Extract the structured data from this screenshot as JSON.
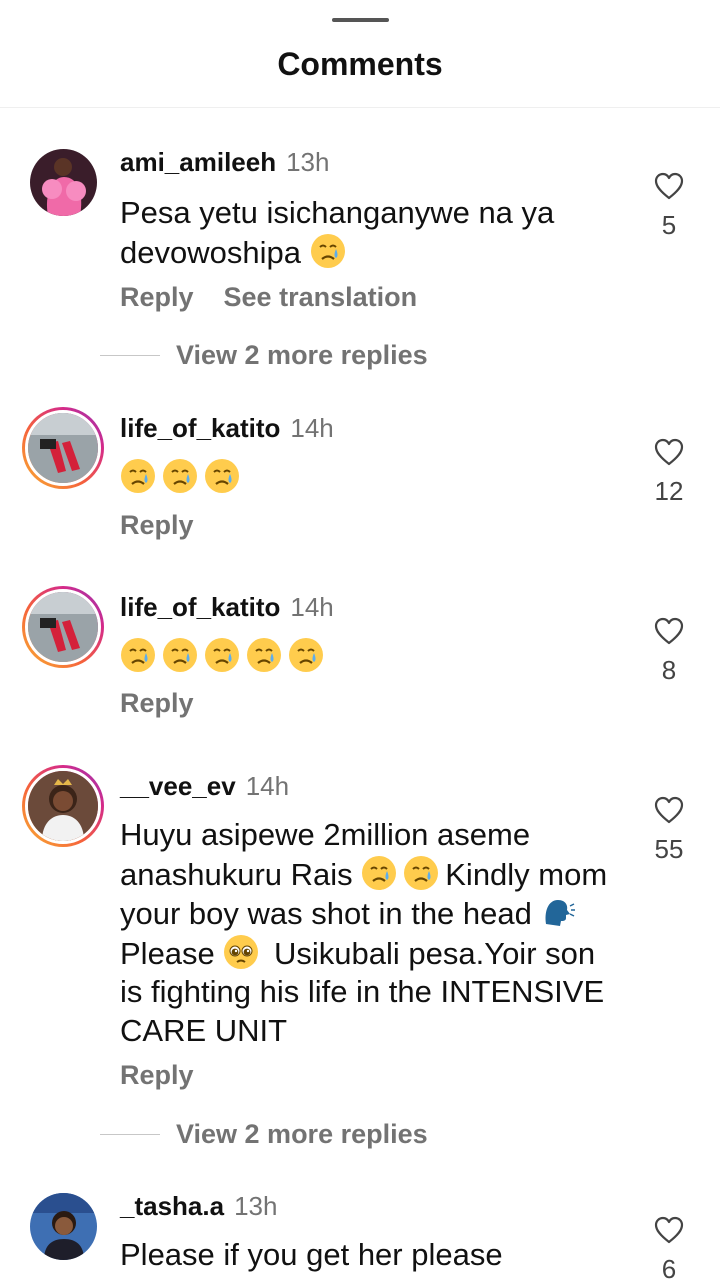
{
  "sheet": {
    "title": "Comments"
  },
  "comments": [
    {
      "username": "ami_amileeh",
      "time": "13h",
      "text": "Pesa yetu isichanganywe na ya devowoshipa",
      "emojis": [
        "crying-face"
      ],
      "reply_label": "Reply",
      "translate_label": "See translation",
      "likes": "5",
      "view_replies": "View 2 more replies",
      "avatar_icon": "avatar-pink-dress",
      "story_ring": false
    },
    {
      "username": "life_of_katito",
      "time": "14h",
      "text": "",
      "emojis": [
        "crying-face",
        "crying-face",
        "crying-face"
      ],
      "reply_label": "Reply",
      "likes": "12",
      "avatar_icon": "avatar-red-shoes",
      "story_ring": true
    },
    {
      "username": "life_of_katito",
      "time": "14h",
      "text": "",
      "emojis": [
        "crying-face",
        "crying-face",
        "crying-face",
        "crying-face",
        "crying-face"
      ],
      "reply_label": "Reply",
      "likes": "8",
      "avatar_icon": "avatar-red-shoes",
      "story_ring": true
    },
    {
      "username": "__vee_ev",
      "time": "14h",
      "text_parts": [
        "Huyu asipewe 2million aseme anashukuru Rais ",
        "Kindly mom your boy was shot in the head ",
        " Please ",
        " Usikubali pesa.Yoir son is fighting his life in the INTENSIVE CARE UNIT"
      ],
      "reply_label": "Reply",
      "likes": "55",
      "view_replies": "View 2 more replies",
      "avatar_icon": "avatar-woman-white-top",
      "story_ring": true
    },
    {
      "username": "_tasha.a",
      "time": "13h",
      "text": "Please if you get her please",
      "likes": "6",
      "avatar_icon": "avatar-woman-blue-bg",
      "story_ring": false
    }
  ],
  "icons": {
    "like": "heart-outline-icon",
    "emoji_cry": "crying-face-emoji",
    "emoji_speak": "speaking-head-emoji",
    "emoji_plead": "pleading-face-emoji"
  },
  "colors": {
    "muted_text": "#737373",
    "text": "#111111",
    "ring_start": "#f9b233",
    "ring_end": "#8a3ab9"
  }
}
